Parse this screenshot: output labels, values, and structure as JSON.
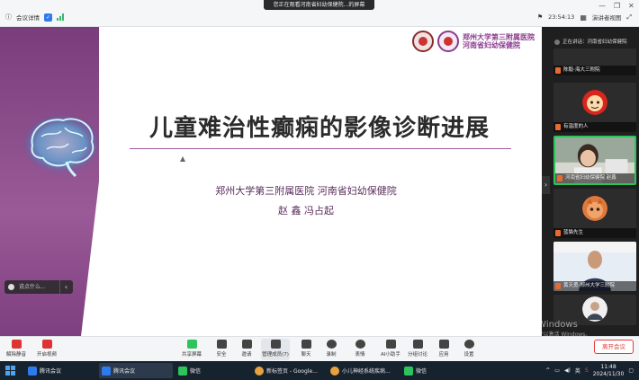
{
  "titlebar": {
    "share_banner": "您正在观看河南省妇幼保健院...的屏幕",
    "meeting_label": "会议详情",
    "time_value": "23:54:13",
    "speaker_view": "演讲者视图",
    "win_controls": [
      "—",
      "❐",
      "✕"
    ]
  },
  "slide": {
    "logo_line1": "郑州大学第三附属医院",
    "logo_line2": "河南省妇幼保健院",
    "title": "儿童难治性癫痫的影像诊断进展",
    "subtitle_1": "郑州大学第三附属医院  河南省妇幼保健院",
    "subtitle_2": "赵  鑫  冯占起",
    "comment_placeholder": "说点什么..."
  },
  "panel": {
    "speaking_label": "正在讲话：河南省妇幼保健院",
    "participants": [
      {
        "name": "陈毅-海大三附院"
      },
      {
        "name": "有温度的人"
      },
      {
        "name": "河南省妇幼保健院 赵鑫"
      },
      {
        "name": "蓝猫先生"
      },
      {
        "name": "黄天勇-郑州大学三附院"
      },
      {
        "name": ""
      }
    ]
  },
  "toolbar": {
    "tools": [
      {
        "label": "解除静音"
      },
      {
        "label": "开启视频"
      },
      {
        "label": "共享屏幕"
      },
      {
        "label": "安全"
      },
      {
        "label": "邀请"
      },
      {
        "label": "管理成员(7)"
      },
      {
        "label": "聊天"
      },
      {
        "label": "录制"
      },
      {
        "label": "表情"
      },
      {
        "label": "AI小助手"
      },
      {
        "label": "分组讨论"
      },
      {
        "label": "应用"
      },
      {
        "label": "设置"
      }
    ],
    "leave_label": "离开会议"
  },
  "watermark": {
    "line1": "激活 Windows",
    "line2": "转到\"设置\"以激活 Windows。"
  },
  "taskbar": {
    "tasks": [
      {
        "label": "腾讯会议",
        "color": "#2e7bef"
      },
      {
        "label": "腾讯会议",
        "color": "#2e7bef"
      },
      {
        "label": "微信",
        "color": "#2ec45c"
      },
      {
        "label": "新标签页 - Google...",
        "color": "#e8a33d"
      },
      {
        "label": "小儿神经系统疾病...",
        "color": "#e8a33d"
      },
      {
        "label": "微信",
        "color": "#2ec45c"
      }
    ],
    "ime": "英",
    "time": "11:48",
    "date": "2024/11/30"
  }
}
